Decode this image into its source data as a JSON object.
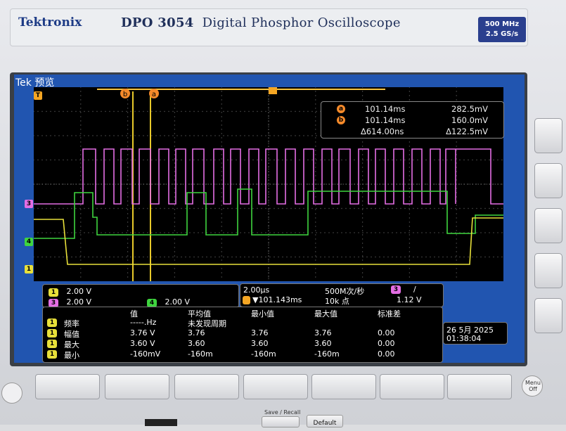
{
  "header": {
    "brand": "Tektronix",
    "model": "DPO 3054",
    "description": "Digital Phosphor Oscilloscope",
    "bandwidth": "500 MHz",
    "sample_rate": "2.5 GS/s"
  },
  "screen": {
    "tek_label": "Tek",
    "mode_label": "预览",
    "trigger_marker": "T",
    "cursor_a_label": "a",
    "cursor_b_label": "b"
  },
  "channel_markers": {
    "ch1": "1",
    "ch3": "3",
    "ch4": "4"
  },
  "cursor_readout": {
    "a_label": "a",
    "b_label": "b",
    "a_time": "101.14ms",
    "a_value": "282.5mV",
    "b_time": "101.14ms",
    "b_value": "160.0mV",
    "delta_time": "Δ614.00ns",
    "delta_value": "Δ122.5mV"
  },
  "channel_scales": {
    "ch1_label": "1",
    "ch1_scale": "2.00 V",
    "ch3_label": "3",
    "ch3_scale": "2.00 V",
    "ch4_label": "4",
    "ch4_scale": "2.00 V"
  },
  "timebase": {
    "time_per_div": "2.00μs",
    "sample_rate": "500M次/秒",
    "trigger_channel": "3",
    "trigger_slope": "/",
    "trigger_pos": "▼101.143ms",
    "record_length": "10k 点",
    "trigger_level": "1.12 V"
  },
  "measurements": {
    "headers": [
      "值",
      "平均值",
      "最小值",
      "最大值",
      "标准差"
    ],
    "rows": [
      {
        "ch": "1",
        "name": "频率",
        "value": "-----.Hz",
        "mean": "未发现周期",
        "min": "",
        "max": "",
        "std": ""
      },
      {
        "ch": "1",
        "name": "幅值",
        "value": "3.76 V",
        "mean": "3.76",
        "min": "3.76",
        "max": "3.76",
        "std": "0.00"
      },
      {
        "ch": "1",
        "name": "最大",
        "value": "3.60 V",
        "mean": "3.60",
        "min": "3.60",
        "max": "3.60",
        "std": "0.00"
      },
      {
        "ch": "1",
        "name": "最小",
        "value": "-160mV",
        "mean": "-160m",
        "min": "-160m",
        "max": "-160m",
        "std": "0.00"
      }
    ]
  },
  "datetime": {
    "date": "26 5月  2025",
    "time": "01:38:04"
  },
  "buttons": {
    "save_recall": "Save / Recall",
    "default": "Default",
    "menu_off": "Menu Off"
  },
  "colors": {
    "ch1": "#e8e03a",
    "ch3": "#e46ee4",
    "ch4": "#3fd53f",
    "cursor": "#f58a2a",
    "trigger": "#f5a623",
    "screen_border": "#2155b0"
  }
}
